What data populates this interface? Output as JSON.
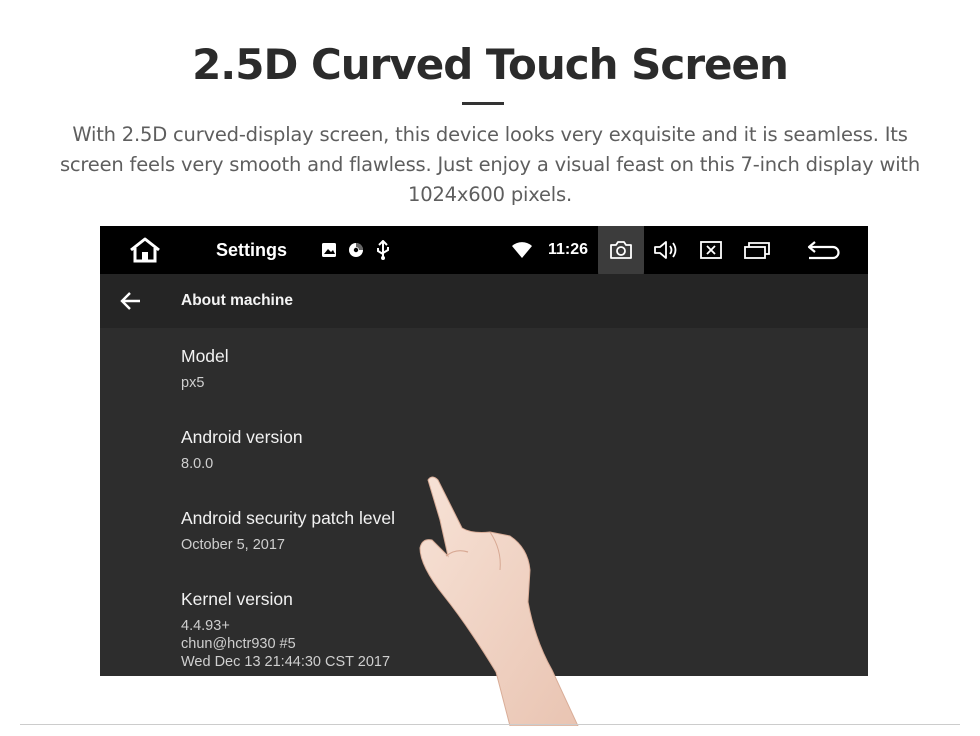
{
  "headline": "2.5D Curved Touch Screen",
  "description": "With 2.5D curved-display screen, this device looks very exquisite and it is seamless. Its screen feels very smooth and flawless. Just enjoy a visual feast on this 7-inch display with 1024x600 pixels.",
  "statusbar": {
    "app_title": "Settings",
    "clock": "11:26",
    "icons": [
      "home-icon",
      "image-icon",
      "disc-icon",
      "usb-icon",
      "wifi-icon",
      "camera-icon",
      "volume-icon",
      "close-box-icon",
      "recent-apps-icon",
      "return-icon"
    ]
  },
  "appbar": {
    "title": "About machine",
    "back_icon": "arrow-left-icon"
  },
  "items": [
    {
      "label": "Model",
      "value": "px5"
    },
    {
      "label": "Android version",
      "value": "8.0.0"
    },
    {
      "label": "Android security patch level",
      "value": "October 5, 2017"
    },
    {
      "label": "Kernel version",
      "value_lines": [
        "4.4.93+",
        "chun@hctr930 #5",
        "Wed Dec 13 21:44:30 CST 2017"
      ]
    }
  ],
  "colors": {
    "screen_bg": "#2d2d2d",
    "statusbar_bg": "#000000",
    "appbar_bg": "#252525"
  }
}
